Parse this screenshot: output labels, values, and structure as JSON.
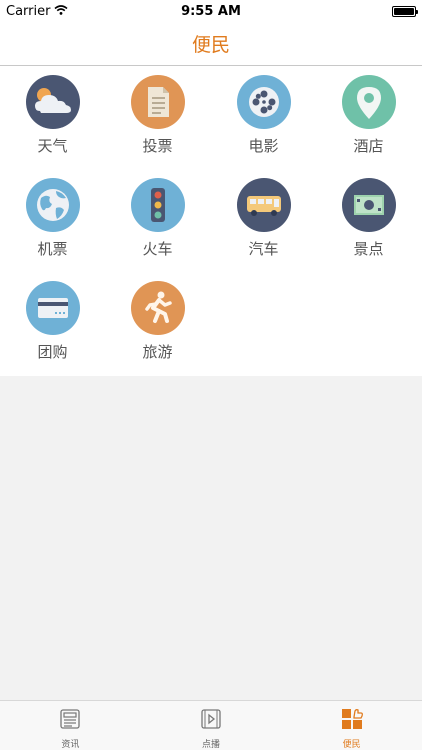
{
  "status": {
    "carrier": "Carrier",
    "time": "9:55 AM"
  },
  "nav": {
    "title": "便民"
  },
  "tiles": [
    {
      "label": "天气",
      "icon": "weather-cloud-icon",
      "color": "#4a5672"
    },
    {
      "label": "投票",
      "icon": "document-icon",
      "color": "#e09555"
    },
    {
      "label": "电影",
      "icon": "film-reel-icon",
      "color": "#6fb1d6"
    },
    {
      "label": "酒店",
      "icon": "location-pin-icon",
      "color": "#6fc1a8"
    },
    {
      "label": "机票",
      "icon": "globe-icon",
      "color": "#6fb1d6"
    },
    {
      "label": "火车",
      "icon": "traffic-light-icon",
      "color": "#6fb1d6"
    },
    {
      "label": "汽车",
      "icon": "bus-icon",
      "color": "#4a5672"
    },
    {
      "label": "景点",
      "icon": "money-icon",
      "color": "#4a5672"
    },
    {
      "label": "团购",
      "icon": "credit-card-icon",
      "color": "#6fb1d6"
    },
    {
      "label": "旅游",
      "icon": "running-person-icon",
      "color": "#e09555"
    }
  ],
  "tabs": [
    {
      "label": "资讯",
      "icon": "newspaper-icon",
      "active": false
    },
    {
      "label": "点播",
      "icon": "video-play-icon",
      "active": false
    },
    {
      "label": "便民",
      "icon": "grid-services-icon",
      "active": true
    }
  ],
  "colors": {
    "accent": "#e07b1e"
  }
}
